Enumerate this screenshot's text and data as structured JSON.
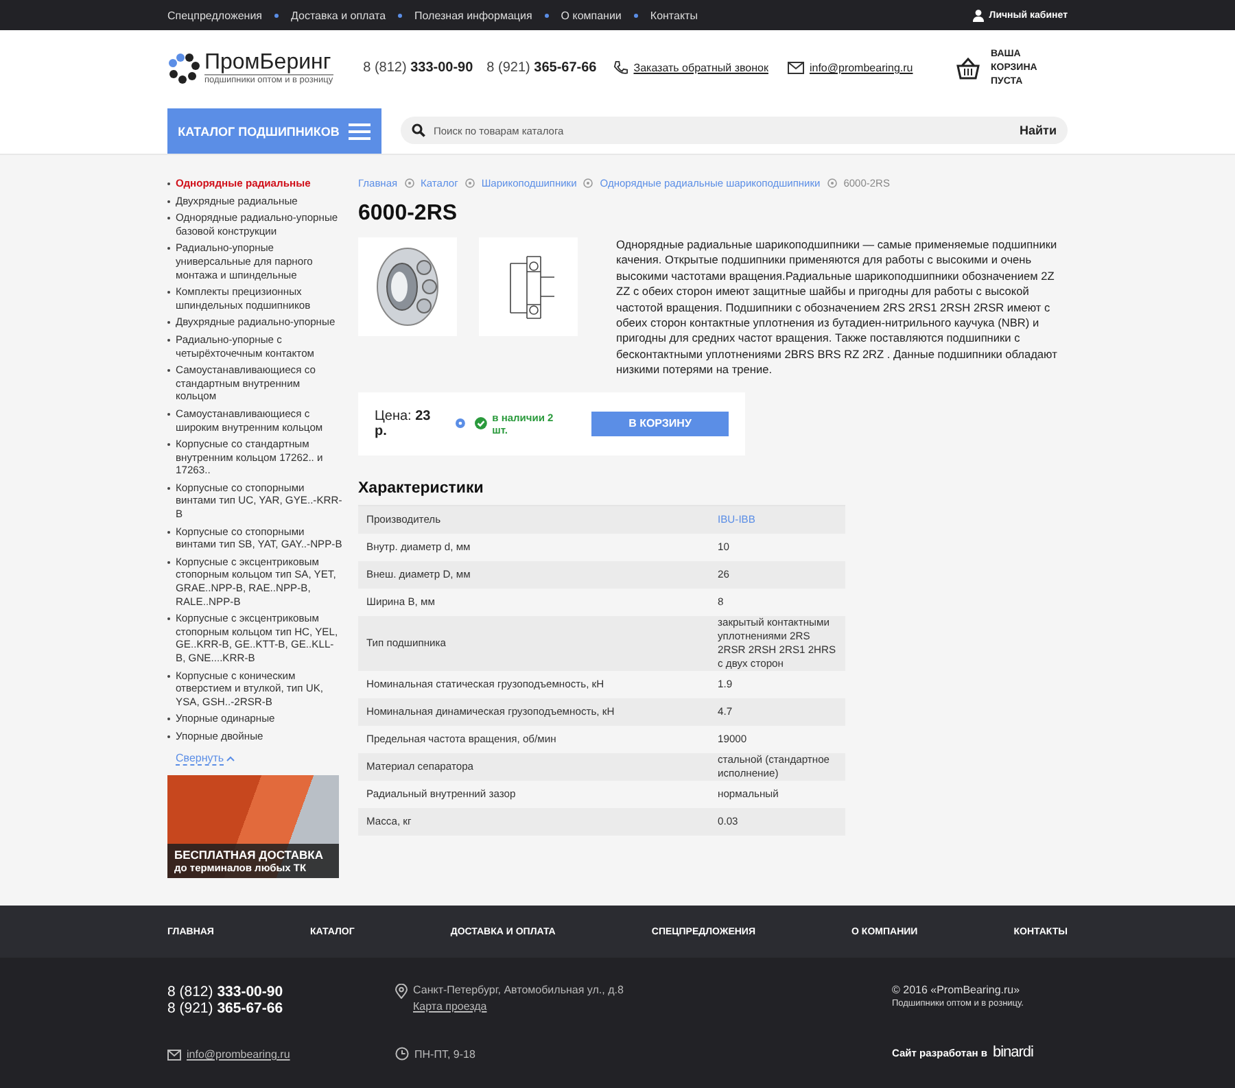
{
  "top_bar": {
    "links": [
      "Спецпредложения",
      "Доставка и оплата",
      "Полезная информация",
      "О компании",
      "Контакты"
    ],
    "account": "Личный кабинет"
  },
  "header": {
    "logo_name": "ПромБеринг",
    "logo_tagline": "подшипники оптом и в розницу",
    "phones": [
      "8 (812) **333-00-90**",
      "8 (921) **365-67-66**"
    ],
    "callback": "Заказать обратный звонок",
    "email": "info@prombearing.ru",
    "cart": "ВАША КОРЗИНА ПУСТА"
  },
  "nav": {
    "catalog_button": "КАТАЛОГ ПОДШИПНИКОВ",
    "search_placeholder": "Поиск по товарам каталога",
    "search_button": "Найти"
  },
  "sidebar": {
    "items": [
      {
        "label": "Однорядные радиальные",
        "selected": true
      },
      {
        "label": "Двухрядные радиальные",
        "selected": false
      },
      {
        "label": "Однорядные радиально-упорные базовой конструкции",
        "selected": false
      },
      {
        "label": "Радиально-упорные универсальные для парного монтажа и шпиндельные",
        "selected": false
      },
      {
        "label": "Комплекты прецизионных шпиндельных подшипников",
        "selected": false
      },
      {
        "label": "Двухрядные радиально-упорные",
        "selected": false
      },
      {
        "label": "Радиально-упорные с четырёхточечным контактом",
        "selected": false
      },
      {
        "label": "Самоустанавливающиеся со стандартным внутренним кольцом",
        "selected": false
      },
      {
        "label": "Самоустанавливающиеся с широким внутренним кольцом",
        "selected": false
      },
      {
        "label": "Корпусные со стандартным внутренним кольцом 17262.. и 17263..",
        "selected": false
      },
      {
        "label": "Корпусные со стопорными винтами тип UC, YAR, GYE..-KRR-B",
        "selected": false
      },
      {
        "label": "Корпусные со стопорными винтами тип SB, YAT, GAY..-NPP-B",
        "selected": false
      },
      {
        "label": "Корпусные с эксцентриковым стопорным кольцом тип SA, YET, GRAE..NPP-B, RAE..NPP-B, RALE..NPP-B",
        "selected": false
      },
      {
        "label": "Корпусные с эксцентриковым стопорным кольцом тип HC, YEL, GE..KRR-B, GE..KTT-B, GE..KLL-B, GNE....KRR-B",
        "selected": false
      },
      {
        "label": "Корпусные с коническим отверстием и втулкой, тип UK, YSA, GSH..-2RSR-B",
        "selected": false
      },
      {
        "label": "Упорные одинарные",
        "selected": false
      },
      {
        "label": "Упорные двойные",
        "selected": false
      }
    ],
    "collapse_link": "Свернуть",
    "banner": {
      "title": "БЕСПЛАТНАЯ ДОСТАВКА",
      "subtitle": "до терминалов любых ТК"
    }
  },
  "breadcrumbs": [
    {
      "label": "Главная",
      "kind": "link"
    },
    {
      "label": "Каталог",
      "kind": "link"
    },
    {
      "label": "Шарикоподшипники",
      "kind": "link"
    },
    {
      "label": "Однорядные радиальные шарикоподшипники",
      "kind": "link"
    },
    {
      "label": "6000-2RS",
      "kind": "current"
    }
  ],
  "product": {
    "title": "6000-2RS",
    "description": "Однорядные радиальные шарикоподшипники — самые применяемые подшипники качения. Открытые подшипники применяются для работы с высокими и очень высокими частотами вращения.Радиальные шарикоподшипники обозначением 2Z ZZ с обеих сторон имеют защитные шайбы и пригодны для работы с высокой частотой вращения. Подшипники с обозначением 2RS 2RS1 2RSH 2RSR имеют с обеих сторон контактные уплотнения из бутадиен-нитрильного каучука (NBR) и пригодны для средних частот вращения. Также поставляются подшипники с бесконтактными уплотнениями 2BRS BRS RZ 2RZ . Данные подшипники обладают низкими потерями на трение.",
    "price_label": "Цена:",
    "price": "23 р.",
    "availability": "в наличии 2 шт.",
    "in_stock": true,
    "cart_button": "В КОРЗИНУ"
  },
  "specs": {
    "title": "Характеристики",
    "rows": [
      {
        "name": "Производитель",
        "value": "IBU-IBB",
        "kind": "link"
      },
      {
        "name": "Внутр. диаметр d, мм",
        "value": "10",
        "kind": "text"
      },
      {
        "name": "Внеш. диаметр D, мм",
        "value": "26",
        "kind": "text"
      },
      {
        "name": "Ширина B, мм",
        "value": "8",
        "kind": "text"
      },
      {
        "name": "Тип подшипника",
        "value": "закрытый контактными уплотнениями 2RS 2RSR 2RSH 2RS1 2HRS с двух сторон",
        "kind": "text"
      },
      {
        "name": "Номинальная статическая грузоподъемность, кН",
        "value": "1.9",
        "kind": "text"
      },
      {
        "name": "Номинальная динамическая грузоподъемность, кН",
        "value": "4.7",
        "kind": "text"
      },
      {
        "name": "Предельная частота вращения, об/мин",
        "value": "19000",
        "kind": "text"
      },
      {
        "name": "Материал сепаратора",
        "value": "стальной (стандартное исполнение)",
        "kind": "text"
      },
      {
        "name": "Радиальный внутренний зазор",
        "value": "нормальный",
        "kind": "text"
      },
      {
        "name": "Масса, кг",
        "value": "0.03",
        "kind": "text"
      }
    ]
  },
  "footer": {
    "nav": [
      "ГЛАВНАЯ",
      "КАТАЛОГ",
      "ДОСТАВКА И ОПЛАТА",
      "СПЕЦПРЕДЛОЖЕНИЯ",
      "О КОМПАНИИ",
      "КОНТАКТЫ"
    ],
    "phones": [
      "8 (812) **333-00-90**",
      "8 (921) **365-67-66**"
    ],
    "email": "info@prombearing.ru",
    "address": "Санкт-Петербург, Автомобильная ул., д.8",
    "map_link": "Карта проезда",
    "hours": "ПН-ПТ, 9-18",
    "copyright": "© 2016 «PromBearing.ru»",
    "tagline": "Подшипники оптом и в розницу.",
    "developer": "Сайт разработан в",
    "developer_logo": "binardi"
  }
}
